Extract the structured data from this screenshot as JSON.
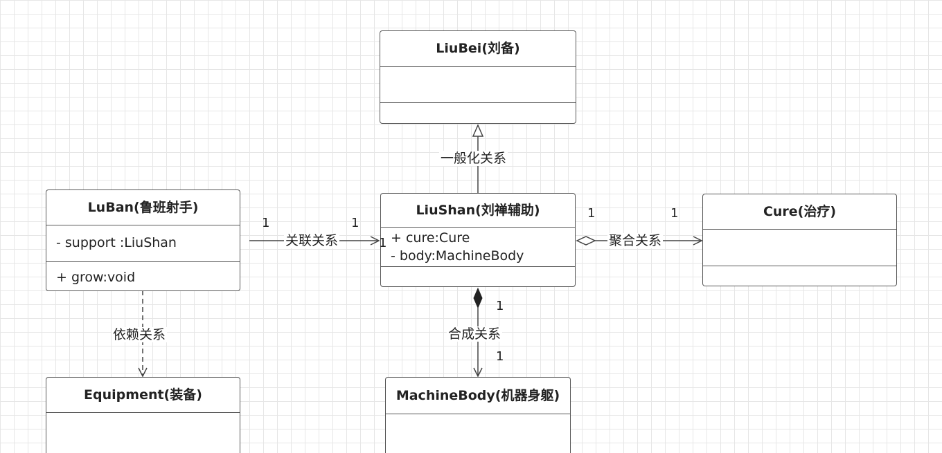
{
  "classes": {
    "liubei": {
      "name": "LiuBei(刘备)"
    },
    "luban": {
      "name": "LuBan(鲁班射手)",
      "attributes": [
        "- support :LiuShan"
      ],
      "methods": [
        "+ grow:void"
      ]
    },
    "liushan": {
      "name": "LiuShan(刘禅辅助)",
      "attributes": [
        "+ cure:Cure",
        "-  body:MachineBody"
      ]
    },
    "cure": {
      "name": "Cure(治疗)"
    },
    "equipment": {
      "name": "Equipment(装备)"
    },
    "machinebody": {
      "name": "MachineBody(机器身躯)"
    }
  },
  "relations": {
    "generalization": {
      "label": "一般化关系"
    },
    "association": {
      "label": "关联关系",
      "mult_source": "1",
      "mult_target": "1",
      "mult_extra": "1"
    },
    "aggregation": {
      "label": "聚合关系",
      "mult_source": "1",
      "mult_target": "1"
    },
    "dependency": {
      "label": "依赖关系"
    },
    "composition": {
      "label": "合成关系",
      "mult_source": "1",
      "mult_target": "1"
    }
  }
}
